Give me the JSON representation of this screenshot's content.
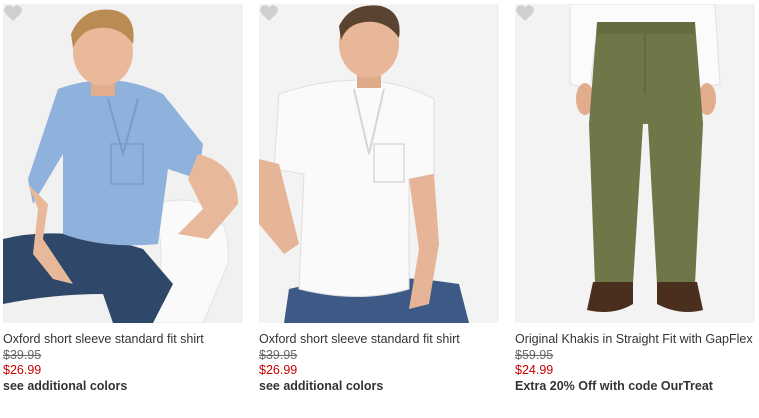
{
  "products": [
    {
      "name": "Oxford short sleeve standard fit shirt",
      "original_price": "$39.95",
      "sale_price": "$26.99",
      "additional_colors_link": "see additional colors",
      "favorite_icon": "heart-icon",
      "image": "man-in-blue-oxford-shirt"
    },
    {
      "name": "Oxford short sleeve standard fit shirt",
      "original_price": "$39.95",
      "sale_price": "$26.99",
      "additional_colors_link": "see additional colors",
      "favorite_icon": "heart-icon",
      "image": "man-in-white-oxford-shirt"
    },
    {
      "name": "Original Khakis in Straight Fit with GapFlex",
      "original_price": "$59.95",
      "sale_price": "$24.99",
      "promo": "Extra 20% Off with code OurTreat",
      "favorite_icon": "heart-icon",
      "image": "olive-khaki-pants"
    }
  ],
  "colors": {
    "sale_price": "#cc0000",
    "text": "#333333",
    "heart": "#cfcfcf",
    "photo_bg": "#efefef"
  }
}
